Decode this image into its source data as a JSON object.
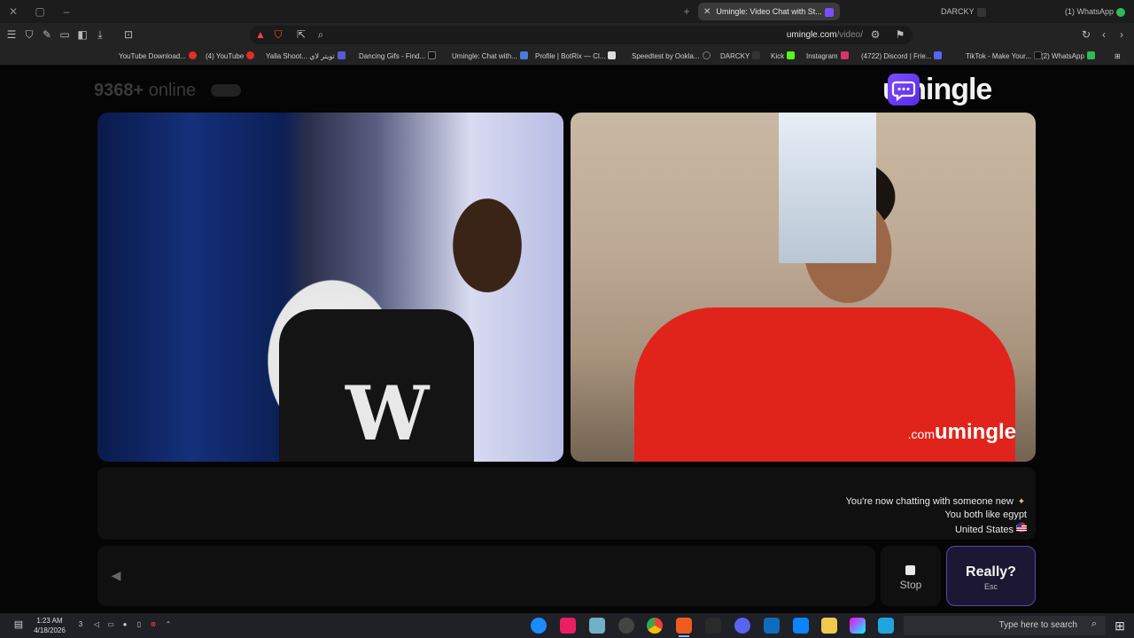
{
  "browser": {
    "tabs": [
      {
        "label": "(1) WhatsApp",
        "active": false
      },
      {
        "label": "DARCKY",
        "active": false
      },
      {
        "label": "Umingle: Video Chat with St...",
        "active": true
      }
    ],
    "new_tab_glyph": "+",
    "url_host": "umingle.com",
    "url_path": "/video/",
    "bookmarks": [
      "(2) WhatsApp",
      "TikTok - Make Your...",
      "(4722) Discord | Frie...",
      "Instagram",
      "Kick",
      "DARCKY",
      "Speedtest by Ookla...",
      "Profile | BotRix — Cl...",
      "Umingle: Chat with...",
      "Dancing Gifs - Find...",
      "Yalla Shoot... تويتر لاي",
      "(4) YouTube",
      "YouTube Download..."
    ]
  },
  "page": {
    "logo_text": "umingle",
    "online_count": "9368+",
    "online_label": "online",
    "watermark": "umingle",
    "watermark_tld": ".com",
    "messages": [
      {
        "icon": "sparkles-icon",
        "text": "You're now chatting with someone new"
      },
      {
        "icon": "",
        "text": "You both like egypt"
      },
      {
        "icon": "us-flag-icon",
        "text": "United States"
      }
    ],
    "stop_label": "Stop",
    "next_label": "Really?",
    "next_key": "Esc"
  },
  "taskbar": {
    "search_placeholder": "Type here to search",
    "time": "1:23 AM",
    "date": "4/18/2026",
    "notification_count": "3"
  },
  "colors": {
    "brand_purple": "#6b3cf5",
    "shirt_red": "#e0241b",
    "background": "#050505"
  }
}
